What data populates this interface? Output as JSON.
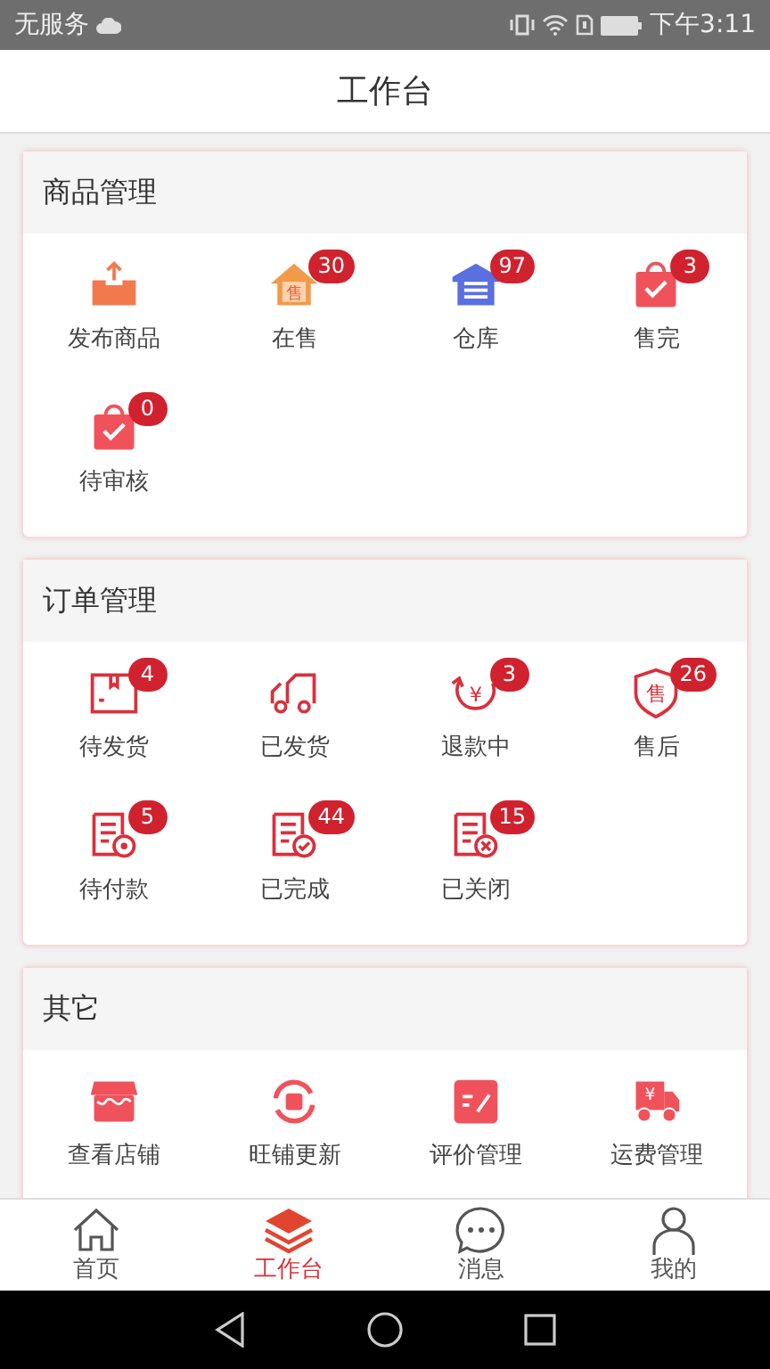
{
  "status_bar": {
    "carrier": "无服务",
    "time": "下午3:11"
  },
  "header": {
    "title": "工作台"
  },
  "sections": [
    {
      "title": "商品管理",
      "items": [
        {
          "label": "发布商品",
          "kind": "upload"
        },
        {
          "label": "在售",
          "kind": "house",
          "icon_text": "售",
          "badge": "30"
        },
        {
          "label": "仓库",
          "kind": "warehouse",
          "badge": "97"
        },
        {
          "label": "售完",
          "kind": "bag",
          "badge": "3"
        },
        {
          "label": "待审核",
          "kind": "bag",
          "badge": "0"
        }
      ]
    },
    {
      "title": "订单管理",
      "items": [
        {
          "label": "待发货",
          "kind": "box",
          "badge": "4"
        },
        {
          "label": "已发货",
          "kind": "truck"
        },
        {
          "label": "退款中",
          "kind": "refund",
          "icon_text": "¥",
          "badge": "3"
        },
        {
          "label": "售后",
          "kind": "shield",
          "icon_text": "售",
          "badge": "26"
        },
        {
          "label": "待付款",
          "kind": "bill-pay",
          "badge": "5"
        },
        {
          "label": "已完成",
          "kind": "bill-done",
          "badge": "44"
        },
        {
          "label": "已关闭",
          "kind": "bill-close",
          "badge": "15"
        }
      ]
    },
    {
      "title": "其它",
      "items": [
        {
          "label": "查看店铺",
          "kind": "store"
        },
        {
          "label": "旺铺更新",
          "kind": "refresh"
        },
        {
          "label": "评价管理",
          "kind": "edit"
        },
        {
          "label": "运费管理",
          "kind": "delivery",
          "icon_text": "¥"
        }
      ]
    }
  ],
  "tab_bar": [
    {
      "label": "首页",
      "kind": "home",
      "selected": false
    },
    {
      "label": "工作台",
      "kind": "layers",
      "selected": true
    },
    {
      "label": "消息",
      "kind": "chat",
      "selected": false
    },
    {
      "label": "我的",
      "kind": "person",
      "selected": false
    }
  ]
}
